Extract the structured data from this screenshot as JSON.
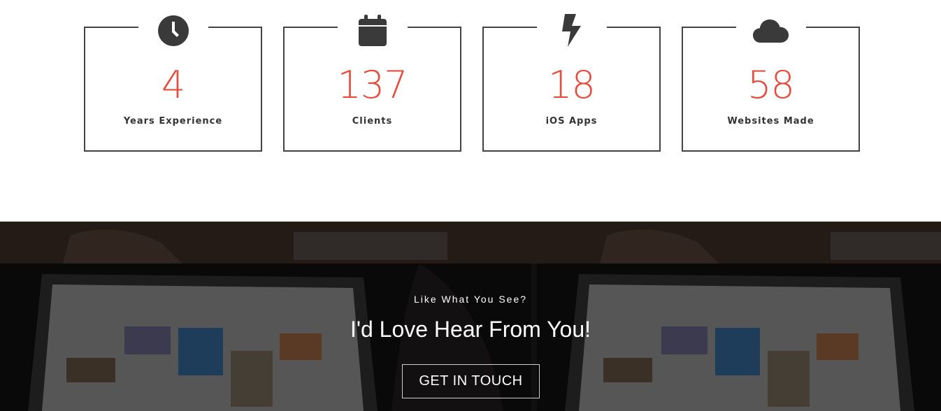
{
  "stats": [
    {
      "icon": "clock-icon",
      "value": "4",
      "label": "Years Experience"
    },
    {
      "icon": "calendar-icon",
      "value": "137",
      "label": "Clients"
    },
    {
      "icon": "lightning-bolt-icon",
      "value": "18",
      "label": "iOS Apps"
    },
    {
      "icon": "cloud-icon",
      "value": "58",
      "label": "Websites Made"
    }
  ],
  "cta": {
    "kicker": "Like What You See?",
    "headline": "I'd Love Hear From You!",
    "button_label": "GET IN TOUCH"
  },
  "colors": {
    "accent": "#e74c3c",
    "border": "#444444",
    "icon": "#3a3a3a"
  }
}
